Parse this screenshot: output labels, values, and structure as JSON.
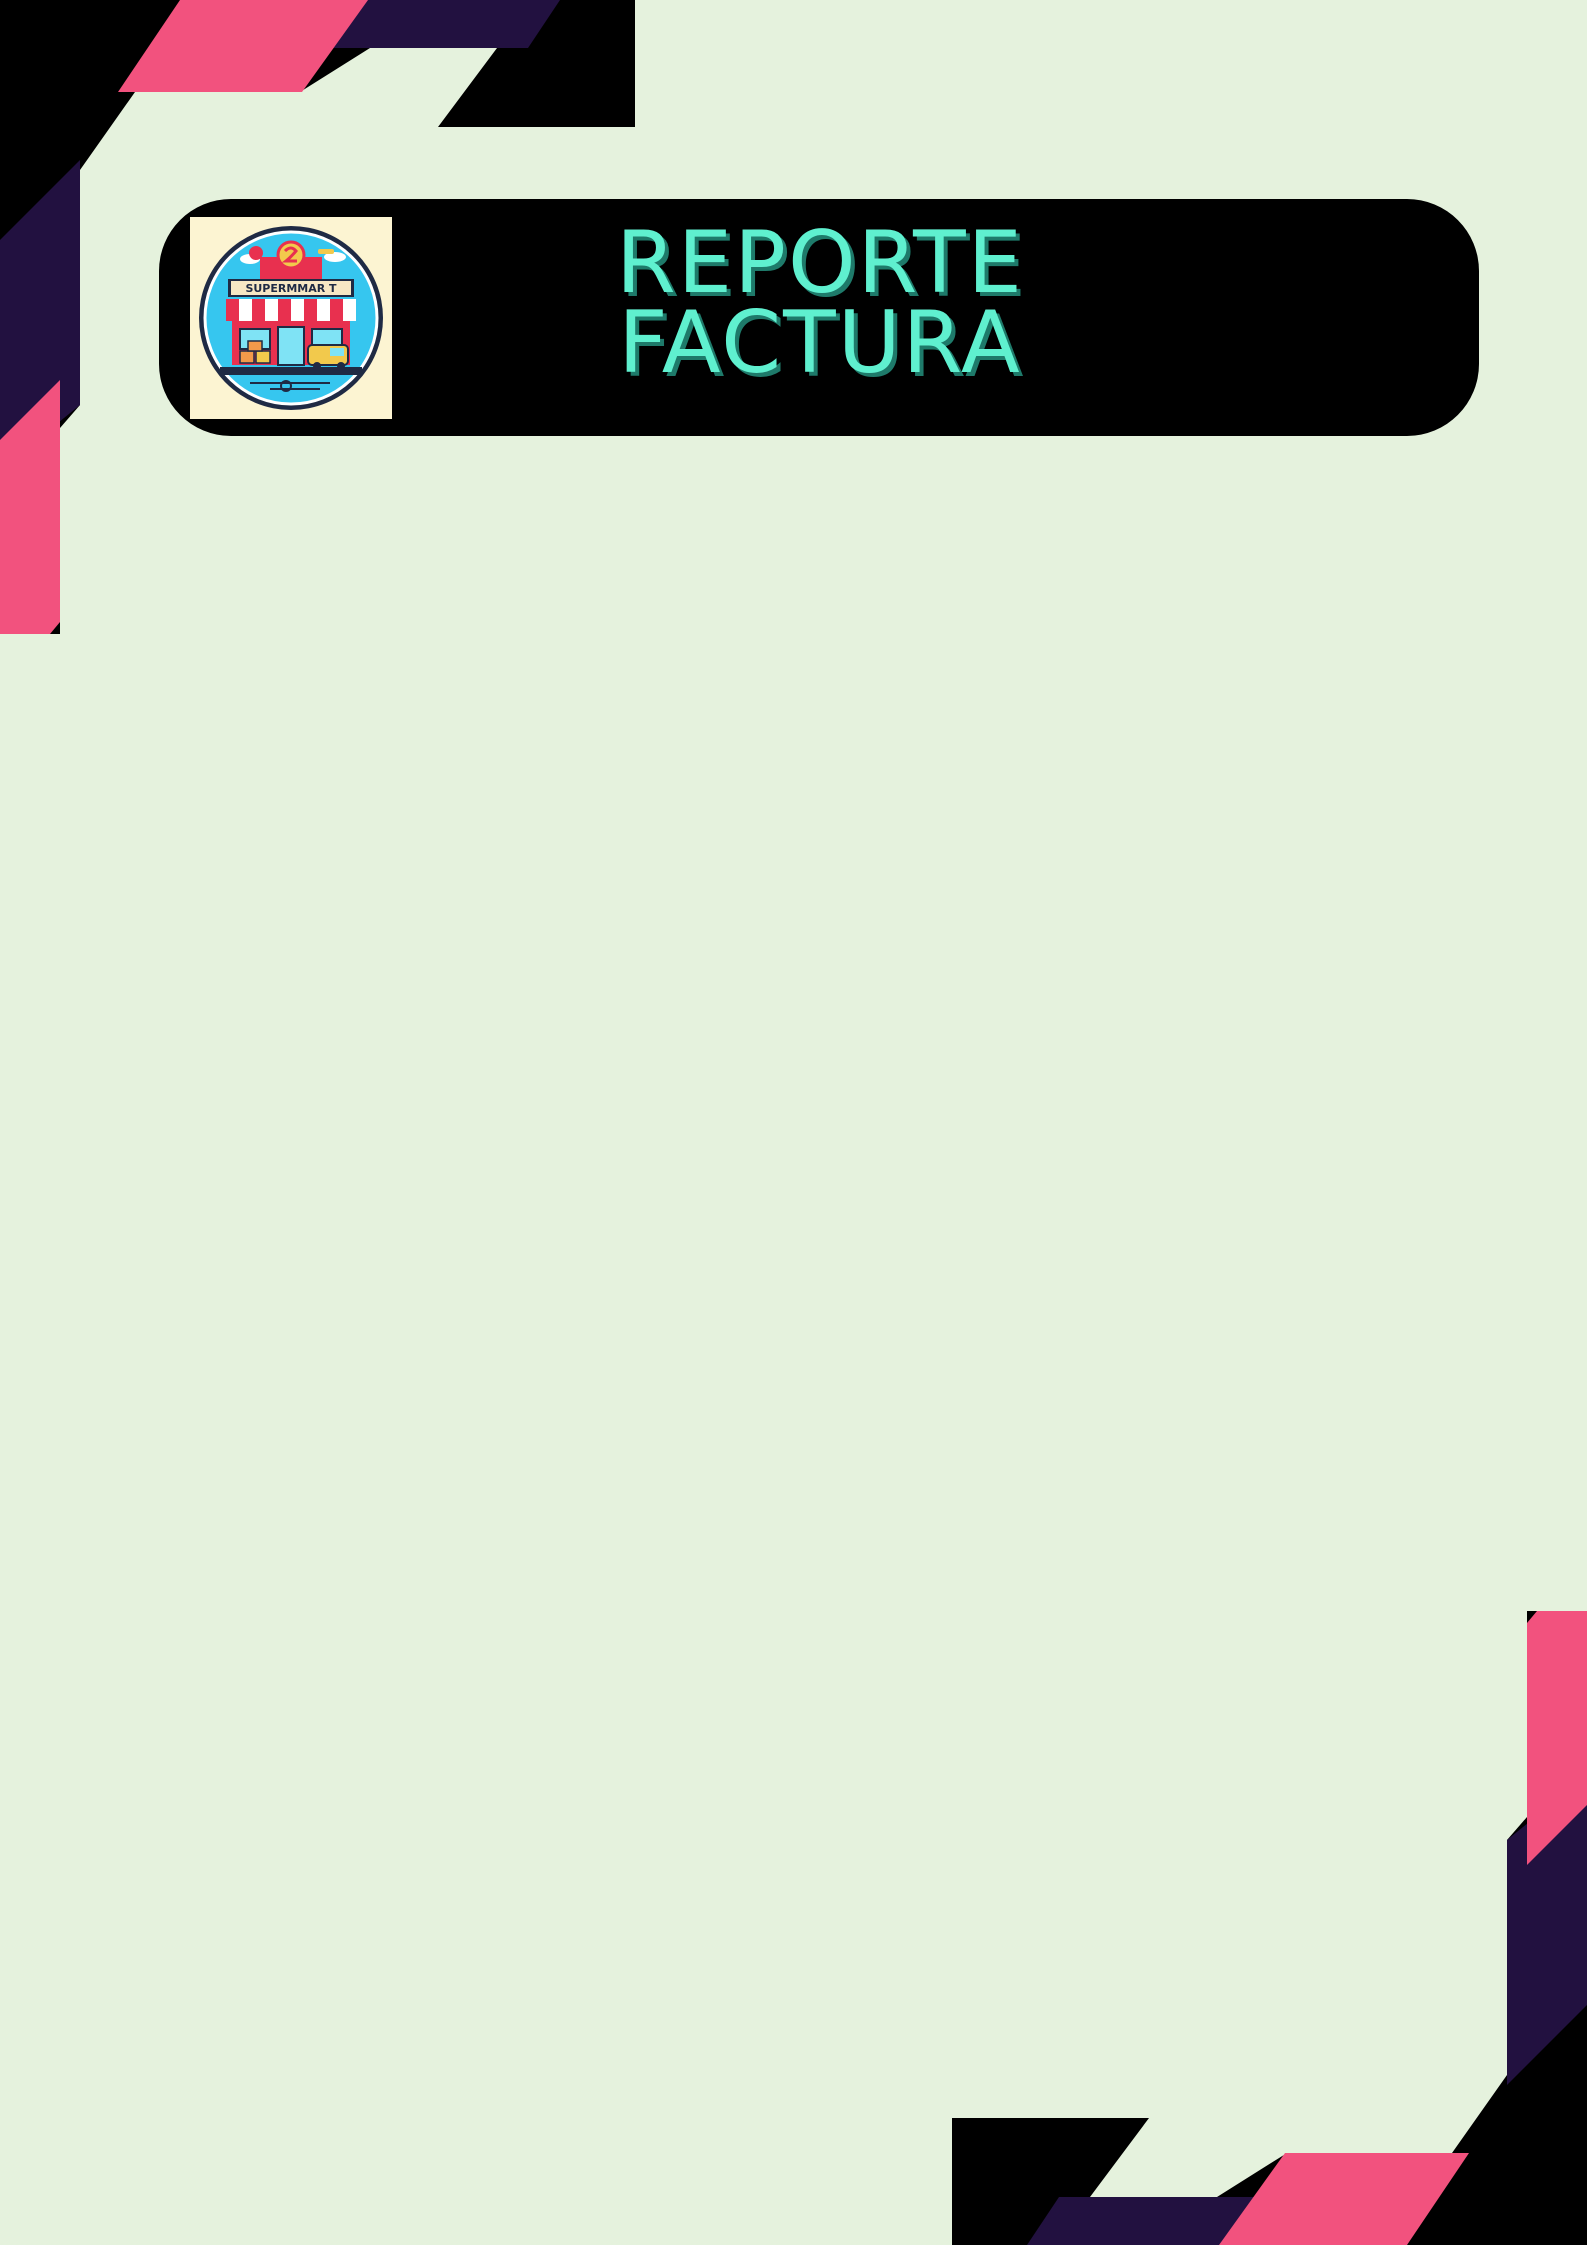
{
  "colors": {
    "background": "#E5F2DD",
    "header_bg": "#000000",
    "title_text": "#5FF0CF",
    "accent_pink": "#F2527E",
    "accent_purple": "#221140",
    "corner_black": "#000000",
    "logo_bg": "#FCF4D2"
  },
  "header": {
    "title_line_1": "REPORTE",
    "title_line_2": "FACTURA"
  },
  "logo": {
    "sign_text": "SUPERMMAR T",
    "icon": "supermarket-storefront-icon"
  }
}
